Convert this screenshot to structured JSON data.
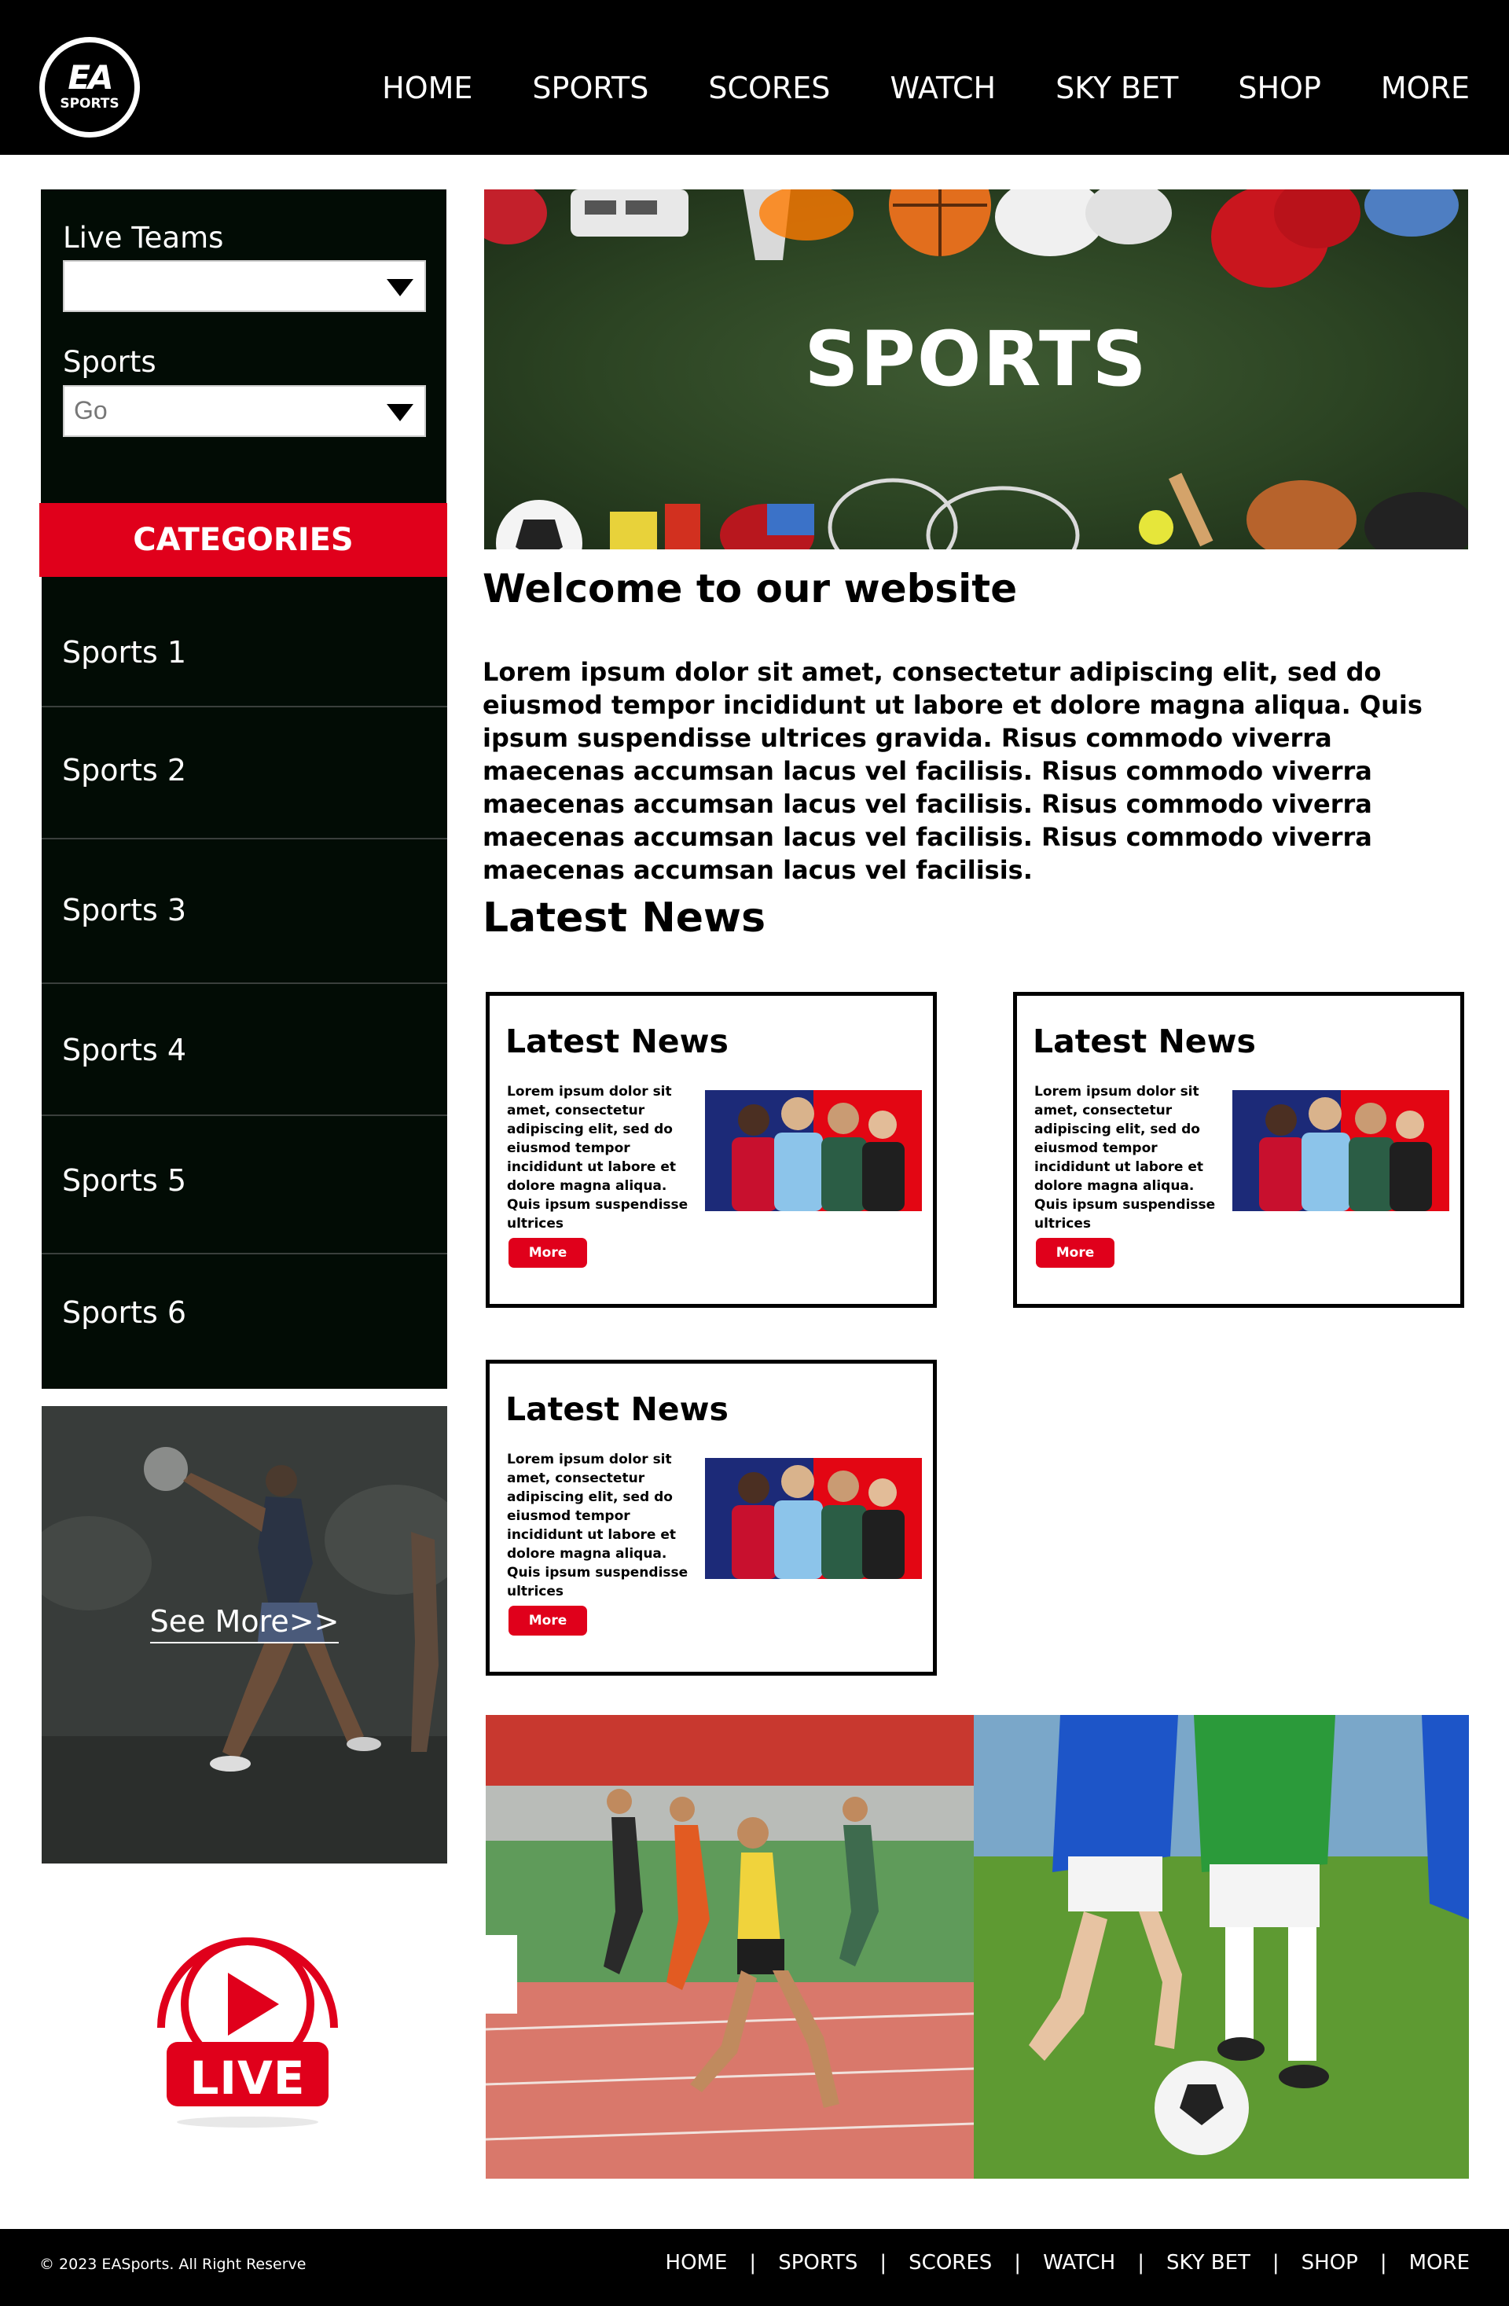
{
  "header": {
    "logo": {
      "line1": "EA",
      "line2": "SPORTS"
    },
    "nav": [
      "HOME",
      "SPORTS",
      "SCORES",
      "WATCH",
      "SKY BET",
      "SHOP",
      "MORE"
    ]
  },
  "sidebar": {
    "live_teams_label": "Live Teams",
    "live_teams_value": "",
    "sports_label": "Sports",
    "sports_value": "Go",
    "categories_title": "CATEGORIES",
    "categories": [
      "Sports 1",
      "Sports 2",
      "Sports 3",
      "Sports 4",
      "Sports 5",
      "Sports 6"
    ],
    "see_more": "See More>>",
    "live_badge_text": "LIVE"
  },
  "hero": {
    "title": "SPORTS"
  },
  "welcome": {
    "title": "Welcome to our website",
    "body": "Lorem ipsum dolor sit amet, consectetur adipiscing elit, sed do eiusmod tempor incididunt ut labore et dolore magna aliqua. Quis ipsum suspendisse ultrices gravida. Risus commodo viverra maecenas accumsan lacus vel facilisis. Risus commodo viverra maecenas accumsan lacus vel facilisis. Risus commodo viverra maecenas accumsan lacus vel facilisis. Risus commodo viverra maecenas accumsan lacus vel facilisis."
  },
  "latest_news": {
    "title": "Latest News",
    "cards": [
      {
        "title": "Latest News",
        "body": "Lorem ipsum dolor sit amet, consectetur adipiscing elit, sed do eiusmod tempor incididunt ut labore et dolore magna aliqua. Quis ipsum suspendisse ultrices",
        "more": "More"
      },
      {
        "title": "Latest News",
        "body": "Lorem ipsum dolor sit amet, consectetur adipiscing elit, sed do eiusmod tempor incididunt ut labore et dolore magna aliqua. Quis ipsum suspendisse ultrices",
        "more": "More"
      },
      {
        "title": "Latest News",
        "body": "Lorem ipsum dolor sit amet, consectetur adipiscing elit, sed do eiusmod tempor incididunt ut labore et dolore magna aliqua. Quis ipsum suspendisse ultrices",
        "more": "More"
      }
    ]
  },
  "footer": {
    "copyright": "© 2023 EASports. All Right Reserve",
    "nav": [
      "HOME",
      "SPORTS",
      "SCORES",
      "WATCH",
      "SKY BET",
      "SHOP",
      "MORE"
    ]
  },
  "colors": {
    "accent": "#e0001b",
    "dark": "#020c05",
    "header": "#000000"
  }
}
